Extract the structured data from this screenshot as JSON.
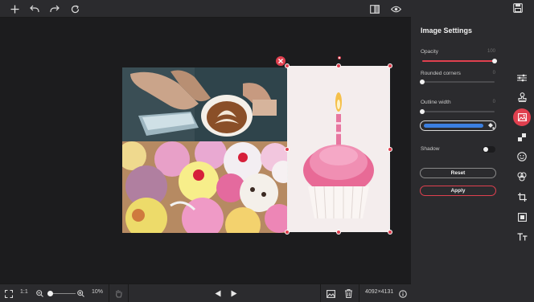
{
  "toolbar": {
    "add_icon": "plus-icon",
    "undo_icon": "undo-icon",
    "redo_icon": "redo-icon",
    "reset_icon": "refresh-icon",
    "compare_icon": "compare-icon",
    "preview_icon": "eye-icon",
    "save_icon": "save-icon"
  },
  "panel": {
    "title": "Image Settings",
    "opacity": {
      "label": "Opacity",
      "value": "100",
      "level": 1.0
    },
    "rounded_corners": {
      "label": "Rounded corners",
      "value": "0",
      "level": 0
    },
    "outline_width": {
      "label": "Outline width",
      "value": "0",
      "level": 0
    },
    "outline_color": "#3b7fe0",
    "shadow": {
      "label": "Shadow",
      "enabled": false
    },
    "reset_label": "Reset",
    "apply_label": "Apply",
    "accent": "#e0404f"
  },
  "rail": [
    "adjust-sliders-icon",
    "stamp-icon",
    "image-icon",
    "checkerboard-icon",
    "smiley-icon",
    "shapes-icon",
    "crop-icon",
    "frame-icon",
    "text-icon"
  ],
  "bottom": {
    "ratio": "1:1",
    "zoom": "10%",
    "dimensions": "4092×4131"
  }
}
